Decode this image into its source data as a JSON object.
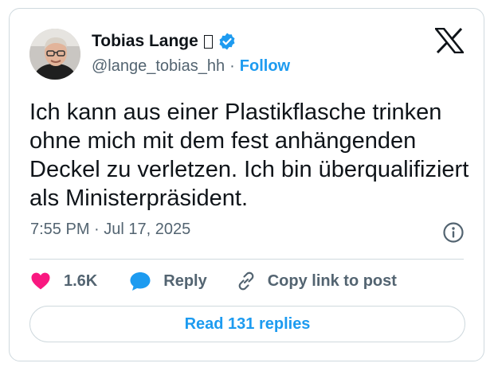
{
  "tweet": {
    "author": {
      "display_name": "Tobias Lange",
      "handle": "@lange_tobias_hh",
      "verified": true,
      "verified_color": "#1d9bf0"
    },
    "follow_label": "Follow",
    "separator": "·",
    "text": "Ich kann aus einer Plastikflasche trinken ohne mich mit dem fest anhängenden Deckel zu verletzen. Ich bin überqualifiziert als Ministerpräsident.",
    "timestamp": "7:55 PM · Jul 17, 2025",
    "actions": {
      "like_count": "1.6K",
      "reply_label": "Reply",
      "copy_link_label": "Copy link to post"
    },
    "read_replies_label": "Read 131 replies"
  },
  "colors": {
    "accent": "#1d9bf0",
    "like": "#f91880",
    "text": "#0f1419",
    "secondary": "#536471",
    "border": "#cfd9de"
  },
  "icons": {
    "platform_logo": "x-logo",
    "verified": "verified-badge-icon",
    "info": "info-icon",
    "like": "heart-icon",
    "reply": "speech-bubble-icon",
    "copy_link": "link-icon"
  }
}
